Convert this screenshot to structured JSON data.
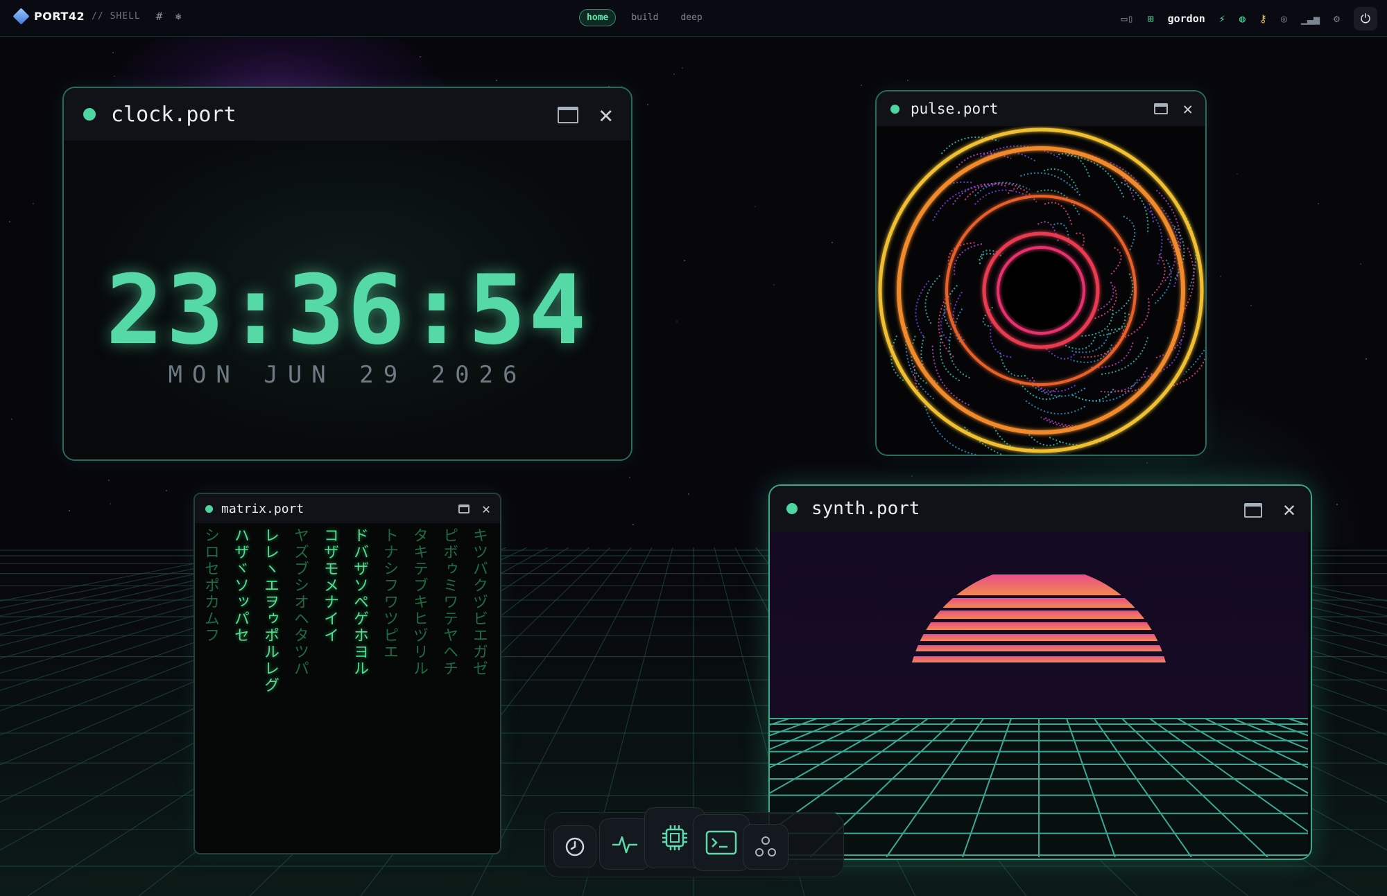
{
  "topbar": {
    "brand": "PORT42",
    "brand_sub": "// SHELL",
    "hash_icon": "#",
    "nav": [
      {
        "label": "home",
        "active": true
      },
      {
        "label": "build",
        "active": false
      },
      {
        "label": "deep",
        "active": false
      }
    ],
    "user": "gordon"
  },
  "windows": {
    "clock": {
      "title": "clock.port",
      "time": "23:36:54",
      "date": "MON JUN 29 2026"
    },
    "pulse": {
      "title": "pulse.port"
    },
    "matrix": {
      "title": "matrix.port",
      "columns": [
        {
          "text": "シロセポカムフ",
          "bright": false
        },
        {
          "text": "ハザヾソッパセ",
          "bright": true
        },
        {
          "text": "レレヽエヲゥポルレグ",
          "bright": true
        },
        {
          "text": "ヤズブシオヘタツパ",
          "bright": false
        },
        {
          "text": "コザモメナイイ",
          "bright": true
        },
        {
          "text": "ドバザソペゲホヨル",
          "bright": true
        },
        {
          "text": "トナシフワツピエ",
          "bright": false
        },
        {
          "text": "タキテブキヒヅリル",
          "bright": false
        },
        {
          "text": "ピボゥミワテヤヘチ",
          "bright": false
        },
        {
          "text": "キツバクヅビエガゼ",
          "bright": false
        }
      ]
    },
    "synth": {
      "title": "synth.port"
    }
  },
  "colors": {
    "accent": "#55d9a6",
    "border": "#2b6b5c",
    "sun_top": "#e94e8a",
    "sun_bottom": "#f28a4e"
  }
}
